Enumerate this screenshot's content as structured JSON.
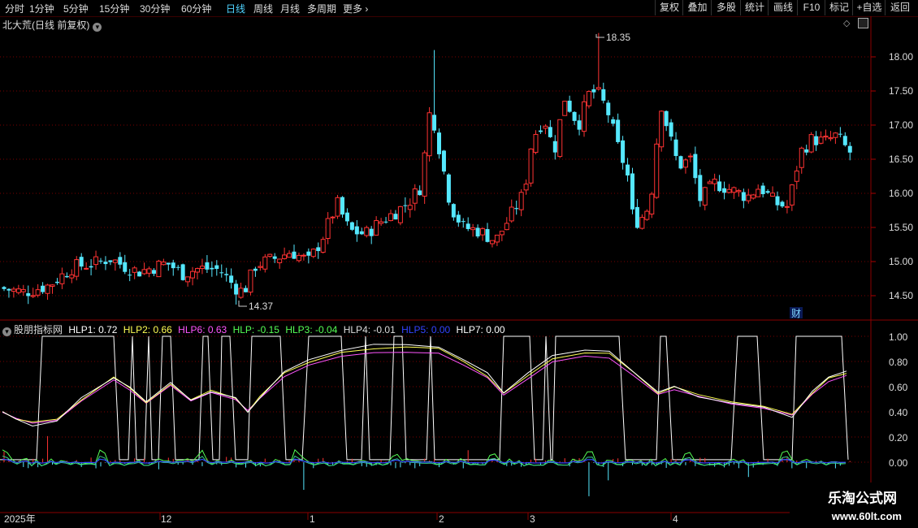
{
  "toolbar": {
    "periods": [
      "分时",
      "1分钟",
      "5分钟",
      "15分钟",
      "30分钟",
      "60分钟",
      "日线",
      "周线",
      "月线",
      "多周期",
      "更多"
    ],
    "active_period": "日线",
    "actions": [
      "复权",
      "叠加",
      "多股",
      "统计",
      "画线",
      "F10",
      "标记",
      "+自选",
      "返回"
    ]
  },
  "main_panel": {
    "title": "北大荒(日线 前复权)",
    "price_labels": [
      "18.00",
      "17.50",
      "17.00",
      "16.50",
      "16.00",
      "15.50",
      "15.00",
      "14.50"
    ],
    "high_label": "18.35",
    "low_label": "14.37",
    "cai_label": "财"
  },
  "indicator_panel": {
    "name": "股朋指标网",
    "items": [
      {
        "label": "HLP1:",
        "value": "0.72",
        "color": "#ffffff"
      },
      {
        "label": "HLP2:",
        "value": "0.66",
        "color": "#ffff55"
      },
      {
        "label": "HLP6:",
        "value": "0.63",
        "color": "#ff55ff"
      },
      {
        "label": "HLP:",
        "value": "-0.15",
        "color": "#55ff55"
      },
      {
        "label": "HLP3:",
        "value": "-0.04",
        "color": "#55ff55"
      },
      {
        "label": "HLP4:",
        "value": "-0.01",
        "color": "#dddddd"
      },
      {
        "label": "HLP5:",
        "value": "0.00",
        "color": "#3344ff"
      },
      {
        "label": "HLP7:",
        "value": "0.00",
        "color": "#ffffff"
      }
    ],
    "axis_labels": [
      "1.00",
      "0.80",
      "0.60",
      "0.40",
      "0.20",
      "0.00"
    ]
  },
  "time_axis": {
    "labels": [
      "2025年",
      "12",
      "1",
      "2",
      "3",
      "4"
    ]
  },
  "watermark": {
    "line1": "乐淘公式网",
    "line2": "www.60lt.com"
  },
  "chart_data": {
    "type": "candlestick",
    "ylim": [
      14.2,
      18.5
    ],
    "high": 18.35,
    "low": 14.37,
    "colors": {
      "up": "#ff3333",
      "down": "#55e8ff"
    }
  }
}
